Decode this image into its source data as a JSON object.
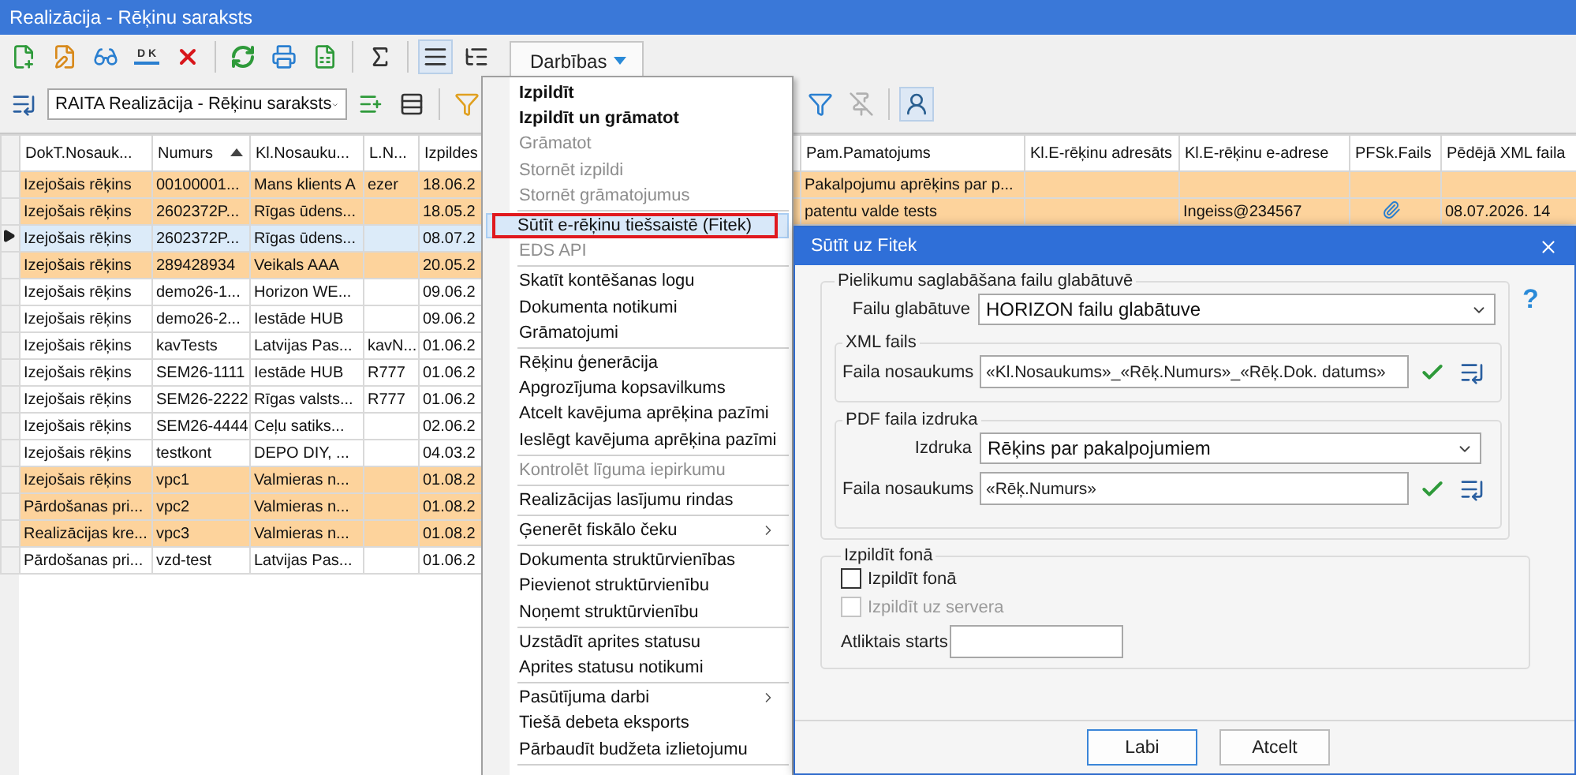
{
  "window": {
    "title": "Realizācija - Rēķinu saraksts"
  },
  "toolbar": {
    "split_label": "D K",
    "actions_button": {
      "label": "Darbības",
      "pressed": true
    }
  },
  "view_bar": {
    "view_select": "RAITA Realizācija - Rēķinu saraksts"
  },
  "table": {
    "columns": [
      {
        "label": "DokT.Nosauk...",
        "sorted": false
      },
      {
        "label": "Numurs",
        "sorted": true
      },
      {
        "label": "Kl.Nosauku...",
        "sorted": false
      },
      {
        "label": "L.N...",
        "sorted": false
      },
      {
        "label": "Izpildes",
        "sorted": false
      },
      {
        "label": "Pam.Pamatojums",
        "sorted": false
      },
      {
        "label": "Kl.E-rēķinu adresāts",
        "sorted": false
      },
      {
        "label": "Kl.E-rēķinu e-adrese",
        "sorted": false
      },
      {
        "label": "PFSk.Fails",
        "sorted": false
      },
      {
        "label": "Pēdējā XML faila",
        "sorted": false
      }
    ],
    "rows": [
      {
        "highlighted": true,
        "selected": false,
        "attachment": false,
        "cells": [
          "Izejošais rēķins",
          "00100001...",
          "Mans klients A",
          "ezer",
          "18.06.2",
          "Pakalpojumu aprēķins par p...",
          null,
          null,
          null,
          null
        ]
      },
      {
        "highlighted": true,
        "selected": false,
        "attachment": true,
        "cells": [
          "Izejošais rēķins",
          "2602372P...",
          "Rīgas ūdens...",
          null,
          "18.05.2",
          "patentu valde tests",
          null,
          "Ingeiss@234567",
          null,
          "08.07.2026. 14"
        ]
      },
      {
        "highlighted": false,
        "selected": true,
        "cells": [
          "Izejošais rēķins",
          "2602372P...",
          "Rīgas ūdens...",
          null,
          "08.07.2",
          null,
          null,
          null,
          null,
          null
        ]
      },
      {
        "highlighted": true,
        "selected": false,
        "cells": [
          "Izejošais rēķins",
          "289428934",
          "Veikals AAA",
          null,
          "20.05.2",
          null,
          null,
          null,
          null,
          null
        ]
      },
      {
        "highlighted": false,
        "selected": false,
        "cells": [
          "Izejošais rēķins",
          "demo26-1...",
          "Horizon WE...",
          null,
          "09.06.2",
          null,
          null,
          null,
          null,
          null
        ]
      },
      {
        "highlighted": false,
        "selected": false,
        "cells": [
          "Izejošais rēķins",
          "demo26-2...",
          "Iestāde HUB",
          null,
          "09.06.2",
          null,
          null,
          null,
          null,
          null
        ]
      },
      {
        "highlighted": false,
        "selected": false,
        "cells": [
          "Izejošais rēķins",
          "kavTests",
          "Latvijas Pas...",
          "kavN...",
          "01.06.2",
          null,
          null,
          null,
          null,
          null
        ]
      },
      {
        "highlighted": false,
        "selected": false,
        "cells": [
          "Izejošais rēķins",
          "SEM26-1111",
          "Iestāde HUB",
          "R777",
          "01.06.2",
          null,
          null,
          null,
          null,
          null
        ]
      },
      {
        "highlighted": false,
        "selected": false,
        "cells": [
          "Izejošais rēķins",
          "SEM26-2222",
          "Rīgas valsts...",
          "R777",
          "01.06.2",
          null,
          null,
          null,
          null,
          null
        ]
      },
      {
        "highlighted": false,
        "selected": false,
        "cells": [
          "Izejošais rēķins",
          "SEM26-4444",
          "Ceļu satiks...",
          null,
          "02.06.2",
          null,
          null,
          null,
          null,
          null
        ]
      },
      {
        "highlighted": false,
        "selected": false,
        "cells": [
          "Izejošais rēķins",
          "testkont",
          "DEPO DIY, ...",
          null,
          "04.03.2",
          null,
          null,
          null,
          null,
          null
        ]
      },
      {
        "highlighted": true,
        "selected": false,
        "cells": [
          "Izejošais rēķins",
          "vpc1",
          "Valmieras n...",
          null,
          "01.08.2",
          null,
          null,
          null,
          null,
          null
        ]
      },
      {
        "highlighted": true,
        "selected": false,
        "cells": [
          "Pārdošanas pri...",
          "vpc2",
          "Valmieras n...",
          null,
          "01.08.2",
          null,
          null,
          null,
          null,
          null
        ]
      },
      {
        "highlighted": true,
        "selected": false,
        "cells": [
          "Realizācijas kre...",
          "vpc3",
          "Valmieras n...",
          null,
          "01.08.2",
          null,
          null,
          null,
          null,
          null
        ]
      },
      {
        "highlighted": false,
        "selected": false,
        "cells": [
          "Pārdošanas pri...",
          "vzd-test",
          "Latvijas Pas...",
          null,
          "01.06.2",
          null,
          null,
          null,
          null,
          null
        ]
      }
    ]
  },
  "actions_menu": {
    "items": [
      {
        "kind": "item",
        "label": "Izpildīt",
        "bold": true,
        "disabled": false,
        "selected": false
      },
      {
        "kind": "item",
        "label": "Izpildīt un grāmatot",
        "bold": true,
        "disabled": false,
        "selected": false
      },
      {
        "kind": "item",
        "label": "Grāmatot",
        "bold": false,
        "disabled": true,
        "selected": false
      },
      {
        "kind": "item",
        "label": "Stornēt izpildi",
        "bold": false,
        "disabled": true,
        "selected": false
      },
      {
        "kind": "item",
        "label": "Stornēt grāmatojumus",
        "bold": false,
        "disabled": true,
        "selected": false
      },
      {
        "kind": "separator"
      },
      {
        "kind": "item",
        "label": "Sūtīt e-rēķinu tiešsaistē (Fitek)",
        "bold": false,
        "disabled": false,
        "selected": true
      },
      {
        "kind": "item",
        "label": "EDS API",
        "bold": false,
        "disabled": true,
        "selected": false
      },
      {
        "kind": "separator"
      },
      {
        "kind": "item",
        "label": "Skatīt kontēšanas logu",
        "bold": false,
        "disabled": false,
        "selected": false
      },
      {
        "kind": "item",
        "label": "Dokumenta notikumi",
        "bold": false,
        "disabled": false,
        "selected": false
      },
      {
        "kind": "item",
        "label": "Grāmatojumi",
        "bold": false,
        "disabled": false,
        "selected": false
      },
      {
        "kind": "separator"
      },
      {
        "kind": "item",
        "label": "Rēķinu ģenerācija",
        "bold": false,
        "disabled": false,
        "selected": false
      },
      {
        "kind": "item",
        "label": "Apgrozījuma kopsavilkums",
        "bold": false,
        "disabled": false,
        "selected": false
      },
      {
        "kind": "item",
        "label": "Atcelt kavējuma aprēķina pazīmi",
        "bold": false,
        "disabled": false,
        "selected": false
      },
      {
        "kind": "item",
        "label": "Ieslēgt kavējuma aprēķina pazīmi",
        "bold": false,
        "disabled": false,
        "selected": false
      },
      {
        "kind": "separator"
      },
      {
        "kind": "item",
        "label": "Kontrolēt līguma iepirkumu",
        "bold": false,
        "disabled": true,
        "selected": false
      },
      {
        "kind": "separator"
      },
      {
        "kind": "item",
        "label": "Realizācijas lasījumu rindas",
        "bold": false,
        "disabled": false,
        "selected": false
      },
      {
        "kind": "separator"
      },
      {
        "kind": "item",
        "label": "Ģenerēt fiskālo čeku",
        "bold": false,
        "disabled": false,
        "selected": false,
        "submenu": true
      },
      {
        "kind": "separator"
      },
      {
        "kind": "item",
        "label": "Dokumenta struktūrvienības",
        "bold": false,
        "disabled": false,
        "selected": false
      },
      {
        "kind": "item",
        "label": "Pievienot struktūrvienību",
        "bold": false,
        "disabled": false,
        "selected": false
      },
      {
        "kind": "item",
        "label": "Noņemt struktūrvienību",
        "bold": false,
        "disabled": false,
        "selected": false
      },
      {
        "kind": "separator"
      },
      {
        "kind": "item",
        "label": "Uzstādīt aprites statusu",
        "bold": false,
        "disabled": false,
        "selected": false
      },
      {
        "kind": "item",
        "label": "Aprites statusu notikumi",
        "bold": false,
        "disabled": false,
        "selected": false
      },
      {
        "kind": "separator"
      },
      {
        "kind": "item",
        "label": "Pasūtījuma darbi",
        "bold": false,
        "disabled": false,
        "selected": false,
        "submenu": true
      },
      {
        "kind": "item",
        "label": "Tiešā debeta eksports",
        "bold": false,
        "disabled": false,
        "selected": false
      },
      {
        "kind": "item",
        "label": "Pārbaudīt budžeta izlietojumu",
        "bold": false,
        "disabled": false,
        "selected": false
      },
      {
        "kind": "separator"
      }
    ]
  },
  "dialog": {
    "title": "Sūtīt uz Fitek",
    "help": "?",
    "storage_group": {
      "title": "Pielikumu saglabāšana failu glabātuvē",
      "storage_label": "Failu glabātuve",
      "storage_value": "HORIZON failu glabātuve",
      "xml_group": {
        "title": "XML fails",
        "name_label": "Faila nosaukums",
        "name_value": "«Kl.Nosaukums»_«Rēķ.Numurs»_«Rēķ.Dok. datums»"
      },
      "pdf_group": {
        "title": "PDF faila izdruka",
        "print_label": "Izdruka",
        "print_value": "Rēķins par pakalpojumiem",
        "name_label": "Faila nosaukums",
        "name_value": "«Rēķ.Numurs»"
      }
    },
    "background_group": {
      "title": "Izpildīt fonā",
      "options": [
        {
          "label": "Izpildīt fonā",
          "checked": false,
          "disabled": false
        },
        {
          "label": "Izpildīt uz servera",
          "checked": false,
          "disabled": true
        }
      ],
      "delayed_label": "Atliktais starts"
    },
    "buttons": [
      {
        "label": "Labi",
        "default": true
      },
      {
        "label": "Atcelt",
        "default": false
      }
    ]
  }
}
